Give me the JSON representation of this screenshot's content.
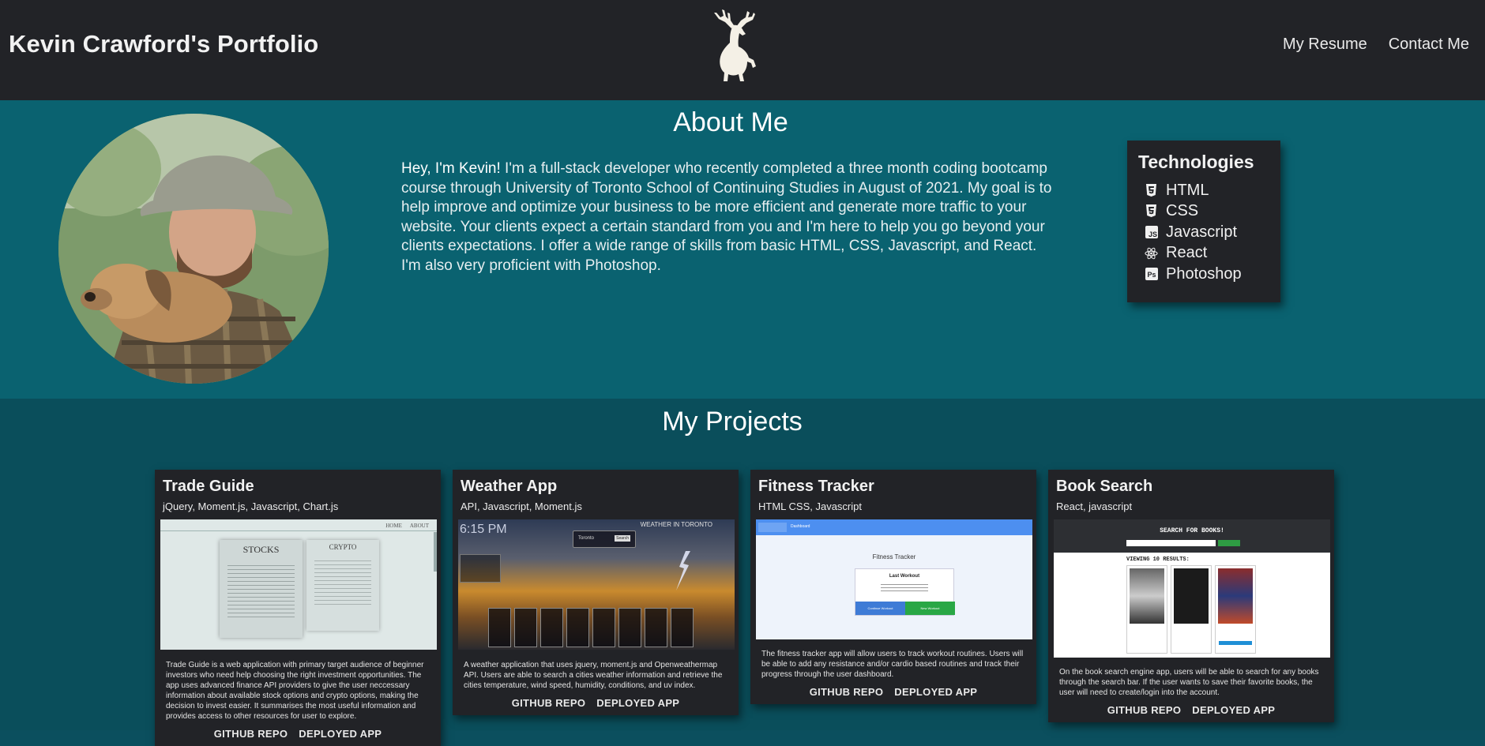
{
  "header": {
    "title": "Kevin Crawford's Portfolio",
    "logo_icon": "deer-icon",
    "nav": [
      {
        "label": "My Resume"
      },
      {
        "label": "Contact Me"
      }
    ]
  },
  "about": {
    "title": "About Me",
    "lead": "Hey, I'm Kevin!",
    "body": " I'm a full-stack developer who recently completed a three month coding bootcamp course through University of Toronto School of Continuing Studies in August of 2021. My goal is to help improve and optimize your business to be more efficient and generate more traffic to your website. Your clients expect a certain standard from you and I'm here to help you go beyond your clients expectations. I offer a wide range of skills from basic HTML, CSS, Javascript, and React. I'm also very proficient with Photoshop."
  },
  "technologies": {
    "title": "Technologies",
    "items": [
      {
        "label": "HTML",
        "icon": "html5-icon"
      },
      {
        "label": "CSS",
        "icon": "css3-icon"
      },
      {
        "label": "Javascript",
        "icon": "js-icon"
      },
      {
        "label": "React",
        "icon": "react-icon"
      },
      {
        "label": "Photoshop",
        "icon": "photoshop-icon"
      }
    ]
  },
  "projects": {
    "title": "My Projects",
    "cards": [
      {
        "title": "Trade Guide",
        "tech": "jQuery, Moment.js, Javascript, Chart.js",
        "description": "Trade Guide is a web application with primary target audience of beginner investors who need help choosing the right investment opportunities. The app uses advanced finance API providers to give the user neccessary information about available stock options and crypto options, making the decision to invest easier. It summarises the most useful information and provides access to other resources for user to explore.",
        "repo_label": "GITHUB REPO",
        "app_label": "DEPLOYED APP"
      },
      {
        "title": "Weather App",
        "tech": "API, Javascript, Moment.js",
        "description": "A weather application that uses jquery, moment.js and Openweathermap API. Users are able to search a cities weather information and retrieve the cities temperature, wind speed, humidity, conditions, and uv index.",
        "repo_label": "GITHUB REPO",
        "app_label": "DEPLOYED APP"
      },
      {
        "title": "Fitness Tracker",
        "tech": "HTML CSS, Javascript",
        "description": "The fitness tracker app will allow users to track workout routines. Users will be able to add any resistance and/or cardio based routines and track their progress through the user dashboard.",
        "repo_label": "GITHUB REPO",
        "app_label": "DEPLOYED APP"
      },
      {
        "title": "Book Search",
        "tech": "React, javascript",
        "description": "On the book search engine app, users will be able to search for any books through the search bar. If the user wants to save their favorite books, the user will need to create/login into the account.",
        "repo_label": "GITHUB REPO",
        "app_label": "DEPLOYED APP"
      }
    ]
  },
  "screenshots": {
    "trade": {
      "nav1": "HOME",
      "nav2": "ABOUT",
      "panel1": "STOCKS",
      "panel2": "CRYPTO"
    },
    "weather": {
      "time": "6:15 PM",
      "city": "WEATHER IN TORONTO",
      "search_value": "Toronto",
      "search_btn": "Search"
    },
    "fitness": {
      "tab": "Dashboard",
      "app_title": "Fitness Tracker",
      "card_title": "Last Workout",
      "btn1": "Continue Workout",
      "btn2": "New Workout"
    },
    "books": {
      "heading": "SEARCH FOR BOOKS!",
      "results": "VIEWING 10 RESULTS:"
    }
  },
  "colors": {
    "header_bg": "#222327",
    "about_bg": "#0a6270",
    "projects_bg": "#0a4e5b",
    "card_bg": "#222327"
  }
}
